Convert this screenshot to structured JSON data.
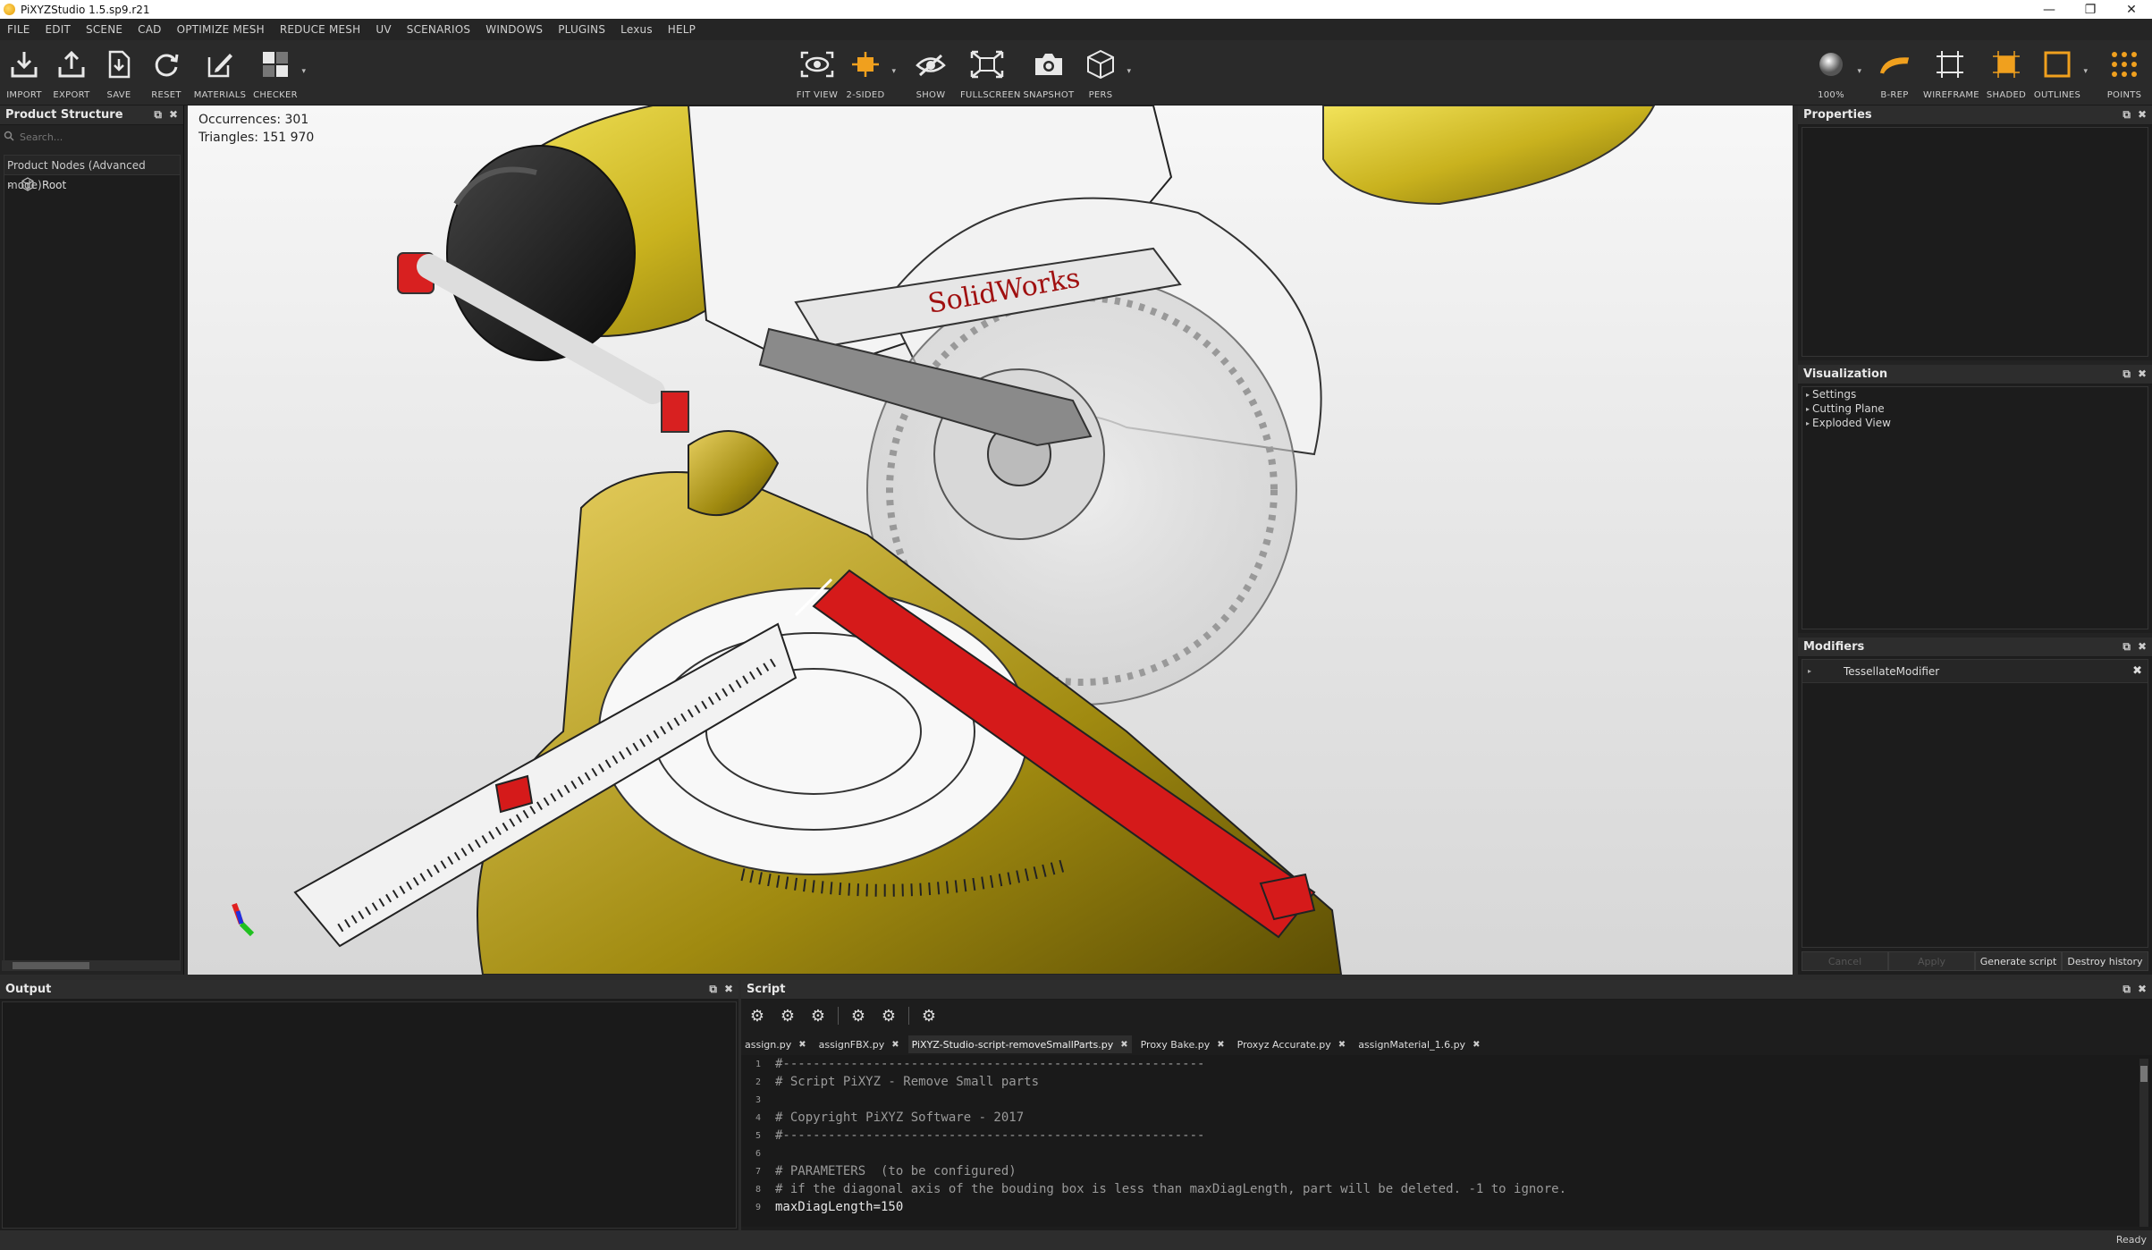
{
  "window": {
    "title": "PiXYZStudio 1.5.sp9.r21"
  },
  "menu": [
    "FILE",
    "EDIT",
    "SCENE",
    "CAD",
    "OPTIMIZE MESH",
    "REDUCE MESH",
    "UV",
    "SCENARIOS",
    "WINDOWS",
    "PLUGINS",
    "Lexus",
    "HELP"
  ],
  "toolbar": {
    "import": "IMPORT",
    "export": "EXPORT",
    "save": "SAVE",
    "reset": "RESET",
    "materials": "MATERIALS",
    "checker": "CHECKER",
    "fit_view": "FIT VIEW",
    "two_sided": "2-SIDED",
    "show": "SHOW",
    "fullscreen": "FULLSCREEN",
    "snapshot": "SNAPSHOT",
    "pers": "PERS",
    "zoom": "100%",
    "brep": "B-REP",
    "wireframe": "WIREFRAME",
    "shaded": "SHADED",
    "outlines": "OUTLINES",
    "points": "POINTS"
  },
  "accent_color": "#f0a01e",
  "product_structure": {
    "title": "Product Structure",
    "search_placeholder": "Search...",
    "nodes_header": "Product Nodes  (Advanced mode)",
    "root": "Root"
  },
  "viewport": {
    "occurrences": "Occurrences: 301",
    "triangles": "Triangles: 151 970",
    "logo_text": "SolidWorks"
  },
  "properties": {
    "title": "Properties"
  },
  "visualization": {
    "title": "Visualization",
    "items": [
      "Settings",
      "Cutting Plane",
      "Exploded View"
    ]
  },
  "modifiers": {
    "title": "Modifiers",
    "item": "TessellateModifier",
    "buttons": [
      "Cancel",
      "Apply",
      "Generate script",
      "Destroy history"
    ]
  },
  "output": {
    "title": "Output"
  },
  "script": {
    "title": "Script",
    "tabs": [
      "assign.py",
      "assignFBX.py",
      "PiXYZ-Studio-script-removeSmallParts.py",
      "Proxy Bake.py",
      "Proxyz Accurate.py",
      "assignMaterial_1.6.py"
    ],
    "lines": [
      "#--------------------------------------------------------",
      "# Script PiXYZ - Remove Small parts",
      "",
      "# Copyright PiXYZ Software - 2017",
      "#--------------------------------------------------------",
      "",
      "# PARAMETERS  (to be configured)",
      "# if the diagonal axis of the bouding box is less than maxDiagLength, part will be deleted. -1 to ignore.",
      "maxDiagLength=150"
    ]
  },
  "status": {
    "text": "Ready"
  }
}
